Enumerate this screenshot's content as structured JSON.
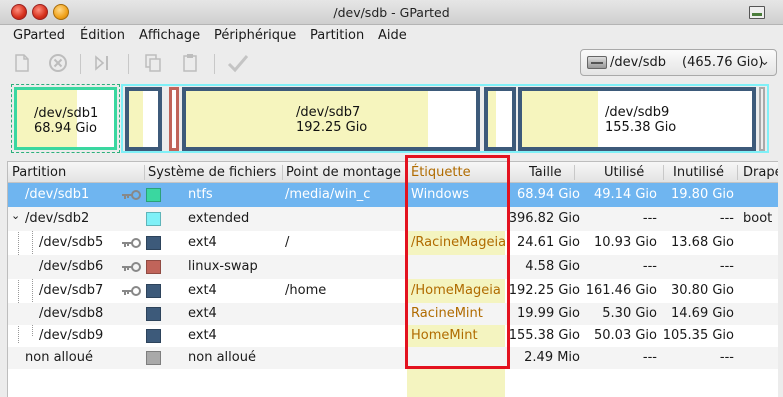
{
  "window": {
    "title": "/dev/sdb - GParted"
  },
  "menubar": {
    "items": [
      "GParted",
      "Édition",
      "Affichage",
      "Périphérique",
      "Partition",
      "Aide"
    ]
  },
  "toolbar": {
    "icons": [
      "new-icon",
      "delete-icon",
      "resize-move-icon",
      "copy-icon",
      "paste-icon",
      "apply-icon"
    ],
    "device_combo": {
      "device": "/dev/sdb",
      "size": "(465.76 Gio)"
    }
  },
  "disk_map": {
    "colors": {
      "border": "#3d5a7a",
      "used_fill": "#f6f5be",
      "ntfs": "#3ad7a0",
      "swap": "#c0645a"
    },
    "partitions": [
      {
        "name": "/dev/sdb1",
        "size": "68.94 Gio"
      },
      {
        "name": "/dev/sdb7",
        "size": "192.25 Gio"
      },
      {
        "name": "/dev/sdb9",
        "size": "155.38 Gio"
      }
    ]
  },
  "table": {
    "headers": {
      "partition": "Partition",
      "filesystem": "Système de fichiers",
      "mountpoint": "Point de montage",
      "label": "Étiquette",
      "size": "Taille",
      "used": "Utilisé",
      "unused": "Inutilisé",
      "flags": "Drape"
    },
    "rows": [
      {
        "partition": "/dev/sdb1",
        "fs": "ntfs",
        "mount": "/media/win_c",
        "label": "Windows",
        "size": "68.94 Gio",
        "used": "49.14 Gio",
        "unused": "19.80 Gio",
        "flags": "",
        "color": "#3ad7a0"
      },
      {
        "partition": "/dev/sdb2",
        "fs": "extended",
        "mount": "",
        "label": "",
        "size": "396.82 Gio",
        "used": "---",
        "unused": "---",
        "flags": "boot",
        "color": "#7ff0f7"
      },
      {
        "partition": "/dev/sdb5",
        "fs": "ext4",
        "mount": "/",
        "label": "/RacineMageia",
        "size": "24.61 Gio",
        "used": "10.93 Gio",
        "unused": "13.68 Gio",
        "flags": "",
        "color": "#3d5a7a"
      },
      {
        "partition": "/dev/sdb6",
        "fs": "linux-swap",
        "mount": "",
        "label": "",
        "size": "4.58 Gio",
        "used": "---",
        "unused": "---",
        "flags": "",
        "color": "#c0645a"
      },
      {
        "partition": "/dev/sdb7",
        "fs": "ext4",
        "mount": "/home",
        "label": "/HomeMageia",
        "size": "192.25 Gio",
        "used": "161.46 Gio",
        "unused": "30.80 Gio",
        "flags": "",
        "color": "#3d5a7a"
      },
      {
        "partition": "/dev/sdb8",
        "fs": "ext4",
        "mount": "",
        "label": "RacineMint",
        "size": "19.99 Gio",
        "used": "5.30 Gio",
        "unused": "14.69 Gio",
        "flags": "",
        "color": "#3d5a7a"
      },
      {
        "partition": "/dev/sdb9",
        "fs": "ext4",
        "mount": "",
        "label": "HomeMint",
        "size": "155.38 Gio",
        "used": "50.03 Gio",
        "unused": "105.35 Gio",
        "flags": "",
        "color": "#3d5a7a"
      },
      {
        "partition": "non alloué",
        "fs": "non alloué",
        "mount": "",
        "label": "",
        "size": "2.49 Mio",
        "used": "---",
        "unused": "---",
        "flags": "",
        "color": "#a9a9a9"
      }
    ]
  }
}
